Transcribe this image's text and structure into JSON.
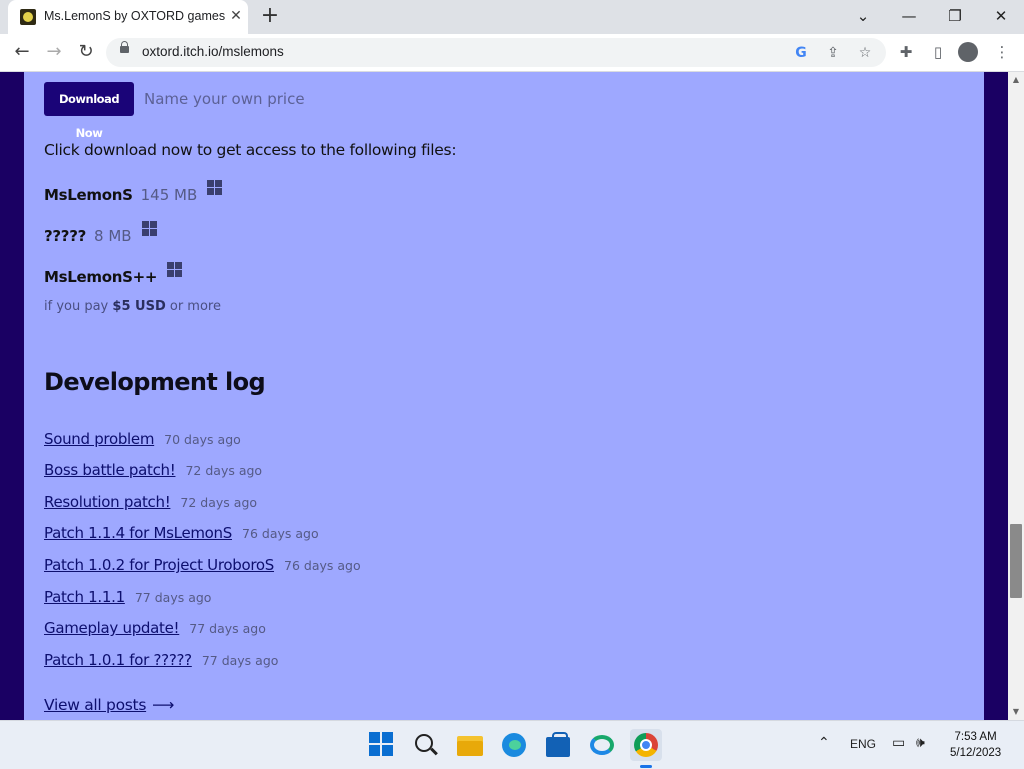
{
  "browser": {
    "tab_title": "Ms.LemonS by OXTORD games",
    "url": "oxtord.itch.io/mslemons"
  },
  "purchase": {
    "download_button": "Download Now",
    "price_text": "Name your own price",
    "intro": "Click download now to get access to the following files:"
  },
  "files": [
    {
      "name": "MsLemonS",
      "size": "145 MB",
      "platform": "windows-icon"
    },
    {
      "name": "?????",
      "size": "8 MB",
      "platform": "windows-icon"
    },
    {
      "name": "MsLemonS++",
      "size": "",
      "platform": "windows-icon"
    }
  ],
  "pay_note": {
    "prefix": "if you pay",
    "amount": "$5 USD",
    "suffix": "or more"
  },
  "devlog": {
    "heading": "Development log",
    "posts": [
      {
        "title": "Sound problem",
        "ago": "70 days ago"
      },
      {
        "title": "Boss battle patch!",
        "ago": "72 days ago"
      },
      {
        "title": "Resolution patch!",
        "ago": "72 days ago"
      },
      {
        "title": "Patch 1.1.4 for MsLemonS",
        "ago": "76 days ago"
      },
      {
        "title": "Patch 1.0.2 for Project UroboroS",
        "ago": "76 days ago"
      },
      {
        "title": "Patch 1.1.1",
        "ago": "77 days ago"
      },
      {
        "title": "Gameplay update!",
        "ago": "77 days ago"
      },
      {
        "title": "Patch 1.0.1 for ?????",
        "ago": "77 days ago"
      }
    ],
    "view_all": "View all posts"
  },
  "taskbar": {
    "language": "ENG",
    "time": "7:53 AM",
    "date": "5/12/2023"
  },
  "colors": {
    "page_bg": "#9ea8ff",
    "side_bg": "#1a0063",
    "button_bg": "#1a0478"
  }
}
